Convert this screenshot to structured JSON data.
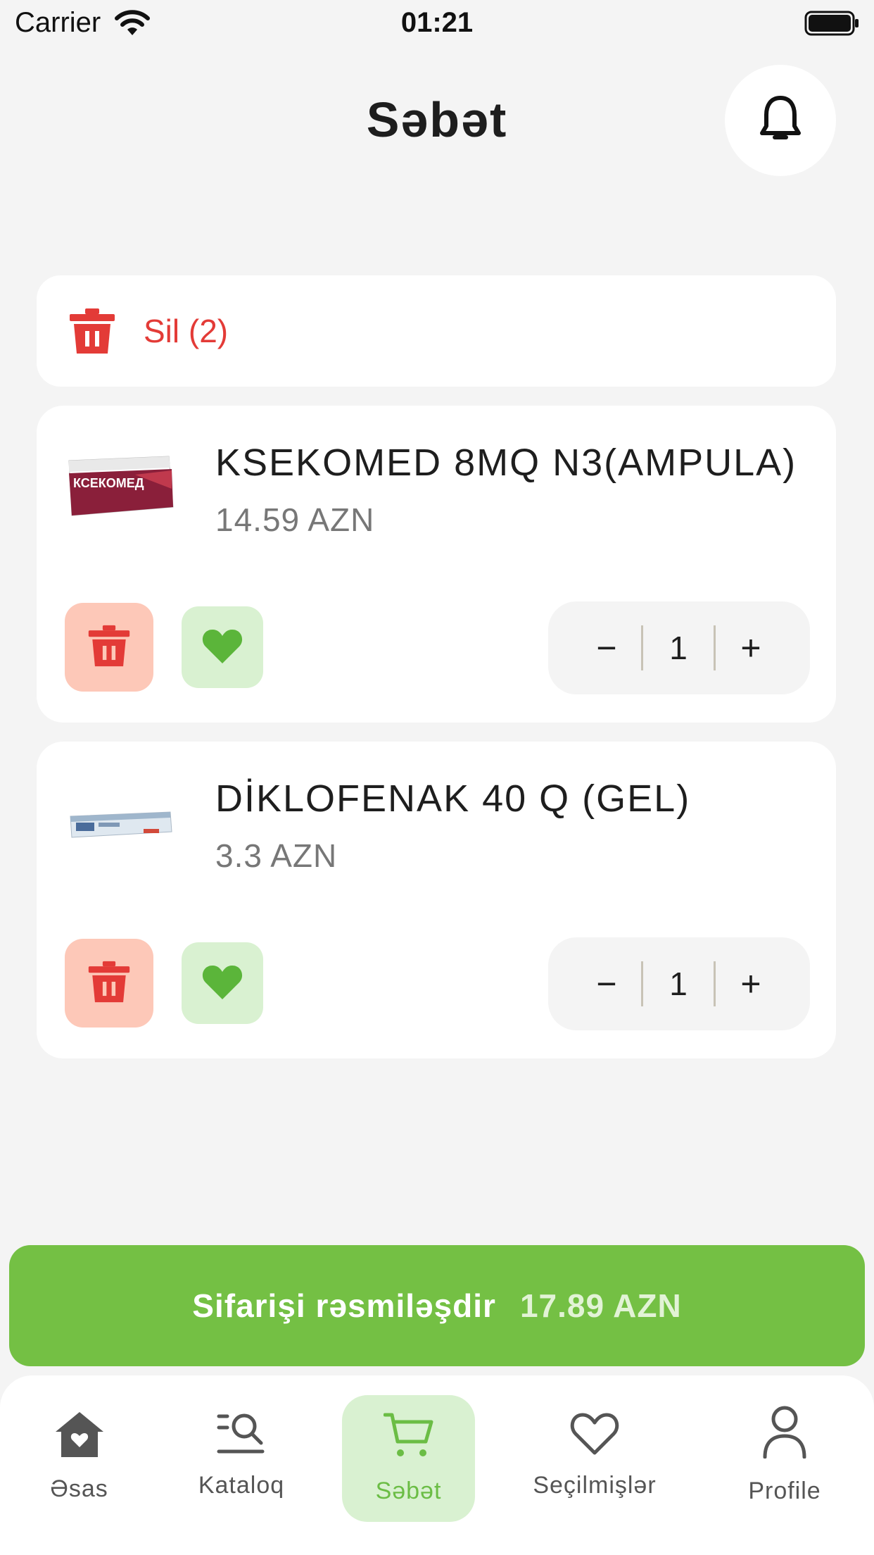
{
  "status": {
    "carrier": "Carrier",
    "time": "01:21"
  },
  "header": {
    "title": "Səbət"
  },
  "cart": {
    "delete_all_label": "Sil (2)",
    "items": [
      {
        "name": "KSEKOMED 8MQ N3(AMPULA)",
        "price": "14.59 AZN",
        "quantity": "1",
        "image_text": "КСЕКОМЕД"
      },
      {
        "name": "DİKLOFENAK 40 Q (GEL)",
        "price": "3.3 AZN",
        "quantity": "1"
      }
    ],
    "stepper": {
      "minus": "−",
      "plus": "+"
    }
  },
  "checkout": {
    "label": "Sifarişi rəsmiləşdir",
    "total": "17.89 AZN"
  },
  "nav": {
    "items": [
      {
        "label": "Əsas",
        "icon": "home-icon"
      },
      {
        "label": "Kataloq",
        "icon": "catalog-search-icon"
      },
      {
        "label": "Səbət",
        "icon": "cart-icon",
        "active": true
      },
      {
        "label": "Seçilmişlər",
        "icon": "heart-outline-icon"
      },
      {
        "label": "Profile",
        "icon": "user-icon"
      }
    ]
  },
  "colors": {
    "accent": "#74c044",
    "danger": "#e33b37",
    "danger_bg": "#fdc8b8",
    "fav_bg": "#d9f1d1",
    "background": "#f4f4f4"
  }
}
